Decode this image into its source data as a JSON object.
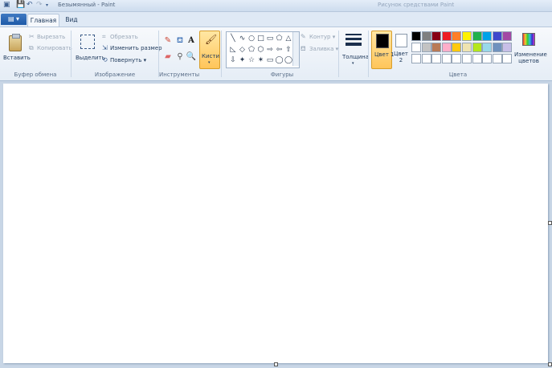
{
  "window": {
    "title": "Безымянный - Paint",
    "right_hint": "Рисунок средствами Paint"
  },
  "quick_access": {
    "save_icon": "save-icon",
    "undo_icon": "undo-icon",
    "redo_icon": "redo-icon"
  },
  "tabs": {
    "file": "▤ ▾",
    "home": "Главная",
    "view": "Вид"
  },
  "clipboard": {
    "paste": "Вставить",
    "cut": "Вырезать",
    "copy": "Копировать",
    "group": "Буфер обмена"
  },
  "image": {
    "select": "Выделить",
    "crop": "Обрезать",
    "resize": "Изменить размер",
    "rotate": "Повернуть ▾",
    "group": "Изображение"
  },
  "tools": {
    "group": "Инструменты",
    "brushes": "Кисти"
  },
  "shapes": {
    "group": "Фигуры",
    "outline": "Контур ▾",
    "fill": "Заливка ▾",
    "row1": [
      "╲",
      "∿",
      "○",
      "□",
      "▭",
      "⬠",
      "△"
    ],
    "row2": [
      "◺",
      "◇",
      "⬠",
      "⬡",
      "⇨",
      "⇦",
      "⇧"
    ],
    "row3": [
      "⇩",
      "✦",
      "☆",
      "✶",
      "▭",
      "◯",
      "◯"
    ]
  },
  "size": {
    "label": "Толщина"
  },
  "colors": {
    "group": "Цвета",
    "color1": "Цвет 1",
    "color2": "Цвет 2",
    "edit": "Изменение цветов",
    "row1": [
      "#000000",
      "#7f7f7f",
      "#880015",
      "#ed1c24",
      "#ff7f27",
      "#fff200",
      "#22b14c",
      "#00a2e8",
      "#3f48cc",
      "#a349a4"
    ],
    "row2": [
      "#ffffff",
      "#c3c3c3",
      "#b97a57",
      "#ffaec9",
      "#ffc90e",
      "#efe4b0",
      "#b5e61d",
      "#99d9ea",
      "#7092be",
      "#c8bfe7"
    ],
    "row3": [
      "#ffffff",
      "#ffffff",
      "#ffffff",
      "#ffffff",
      "#ffffff",
      "#ffffff",
      "#ffffff",
      "#ffffff",
      "#ffffff",
      "#ffffff"
    ]
  }
}
